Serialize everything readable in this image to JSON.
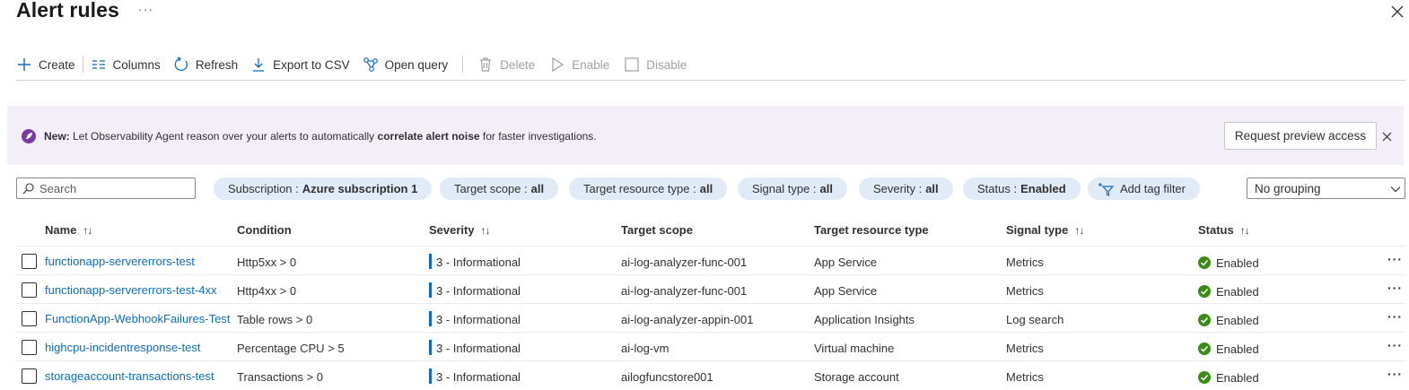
{
  "header": {
    "title": "Alert rules",
    "more": "···"
  },
  "toolbar": {
    "create": "Create",
    "columns": "Columns",
    "refresh": "Refresh",
    "export": "Export to CSV",
    "open_query": "Open query",
    "delete": "Delete",
    "enable": "Enable",
    "disable": "Disable"
  },
  "banner": {
    "new_label": "New:",
    "text_1": " Let Observability Agent reason over your alerts to automatically ",
    "bold": "correlate alert noise",
    "text_2": " for faster investigations.",
    "button": "Request preview access"
  },
  "search": {
    "placeholder": "Search"
  },
  "filters": [
    {
      "label": "Subscription :",
      "value": "Azure subscription 1"
    },
    {
      "label": "Target scope :",
      "value": "all"
    },
    {
      "label": "Target resource type :",
      "value": "all"
    },
    {
      "label": "Signal type :",
      "value": "all"
    },
    {
      "label": "Severity :",
      "value": "all"
    },
    {
      "label": "Status :",
      "value": "Enabled"
    }
  ],
  "add_tag_filter": "Add tag filter",
  "grouping": "No grouping",
  "columns": {
    "name": "Name",
    "condition": "Condition",
    "severity": "Severity",
    "target_scope": "Target scope",
    "target_resource_type": "Target resource type",
    "signal_type": "Signal type",
    "status": "Status",
    "sort_glyph": "↑↓"
  },
  "rows": [
    {
      "name": "functionapp-servererrors-test",
      "condition": "Http5xx > 0",
      "severity": "3 - Informational",
      "target_scope": "ai-log-analyzer-func-001",
      "resource_type": "App Service",
      "signal_type": "Metrics",
      "status": "Enabled"
    },
    {
      "name": "functionapp-servererrors-test-4xx",
      "condition": "Http4xx > 0",
      "severity": "3 - Informational",
      "target_scope": "ai-log-analyzer-func-001",
      "resource_type": "App Service",
      "signal_type": "Metrics",
      "status": "Enabled"
    },
    {
      "name": "FunctionApp-WebhookFailures-Test",
      "condition": "Table rows > 0",
      "severity": "3 - Informational",
      "target_scope": "ai-log-analyzer-appin-001",
      "resource_type": "Application Insights",
      "signal_type": "Log search",
      "status": "Enabled"
    },
    {
      "name": "highcpu-incidentresponse-test",
      "condition": "Percentage CPU > 5",
      "severity": "3 - Informational",
      "target_scope": "ai-log-vm",
      "resource_type": "Virtual machine",
      "signal_type": "Metrics",
      "status": "Enabled"
    },
    {
      "name": "storageaccount-transactions-test",
      "condition": "Transactions > 0",
      "severity": "3 - Informational",
      "target_scope": "ailogfuncstore001",
      "resource_type": "Storage account",
      "signal_type": "Metrics",
      "status": "Enabled"
    }
  ],
  "row_more": "···",
  "colors": {
    "accent": "#0f6cbd",
    "enabled_green": "#3a8a16",
    "banner_bg": "#f4eef8",
    "pill_bg": "#e1ebf7"
  }
}
